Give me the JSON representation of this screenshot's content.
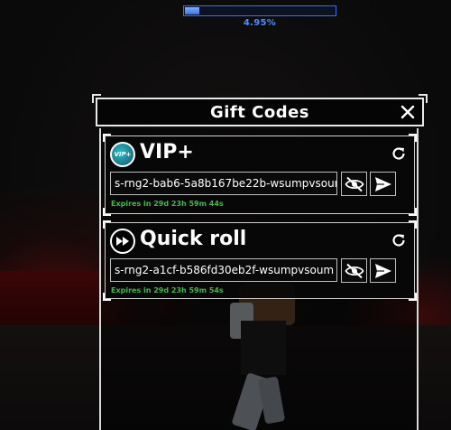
{
  "progress": {
    "label": "4.95%",
    "value_percent": 4.95,
    "fill_color": "#3a72e8",
    "border_color": "#3d6fd6"
  },
  "panel": {
    "title": "Gift Codes",
    "close_icon": "close-icon"
  },
  "codes": [
    {
      "title": "VIP+",
      "icon": "vip-badge-icon",
      "icon_text": "VIP+",
      "code": "s-rng2-bab6-5a8b167be22b-wsumpvsoum",
      "expires": "Expires in 29d 23h 59m 44s"
    },
    {
      "title": "Quick roll",
      "icon": "fast-forward-icon",
      "code": "s-rng2-a1cf-b586fd30eb2f-wsumpvsoum",
      "expires": "Expires in 29d 23h 59m 54s"
    }
  ],
  "colors": {
    "expires_text": "#3fb84a",
    "panel_border": "#e8e8e8",
    "background": "#0a0a0a"
  }
}
